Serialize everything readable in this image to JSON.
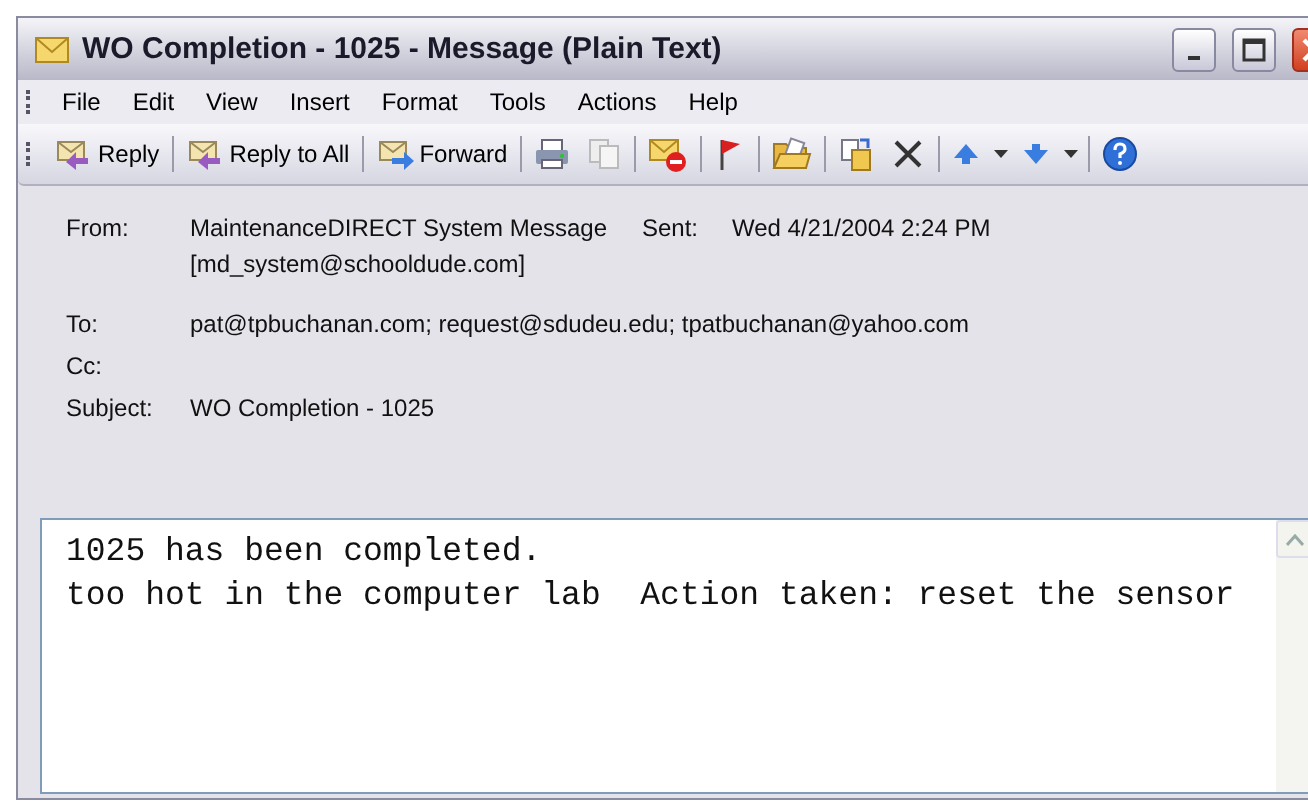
{
  "window": {
    "title": "WO Completion - 1025 - Message (Plain Text)"
  },
  "menu": [
    "File",
    "Edit",
    "View",
    "Insert",
    "Format",
    "Tools",
    "Actions",
    "Help"
  ],
  "toolbar": {
    "buttons": [
      {
        "label": "Reply"
      },
      {
        "label": "Reply to All"
      },
      {
        "label": "Forward"
      }
    ]
  },
  "header": {
    "from": {
      "label": "From:",
      "lines": [
        "MaintenanceDIRECT System Message",
        "[md_system@schooldude.com]"
      ]
    },
    "sent": {
      "label": "Sent:",
      "value": "Wed 4/21/2004 2:24 PM"
    },
    "fields": [
      {
        "label": "To:",
        "value": "pat@tpbuchanan.com; request@sdudeu.edu; tpatbuchanan@yahoo.com"
      },
      {
        "label": "Cc:"
      },
      {
        "label": "Subject:",
        "value": "WO Completion - 1025"
      }
    ]
  },
  "body": [
    "1025 has been completed.",
    "too hot in the computer lab  Action taken: reset the sensor"
  ]
}
